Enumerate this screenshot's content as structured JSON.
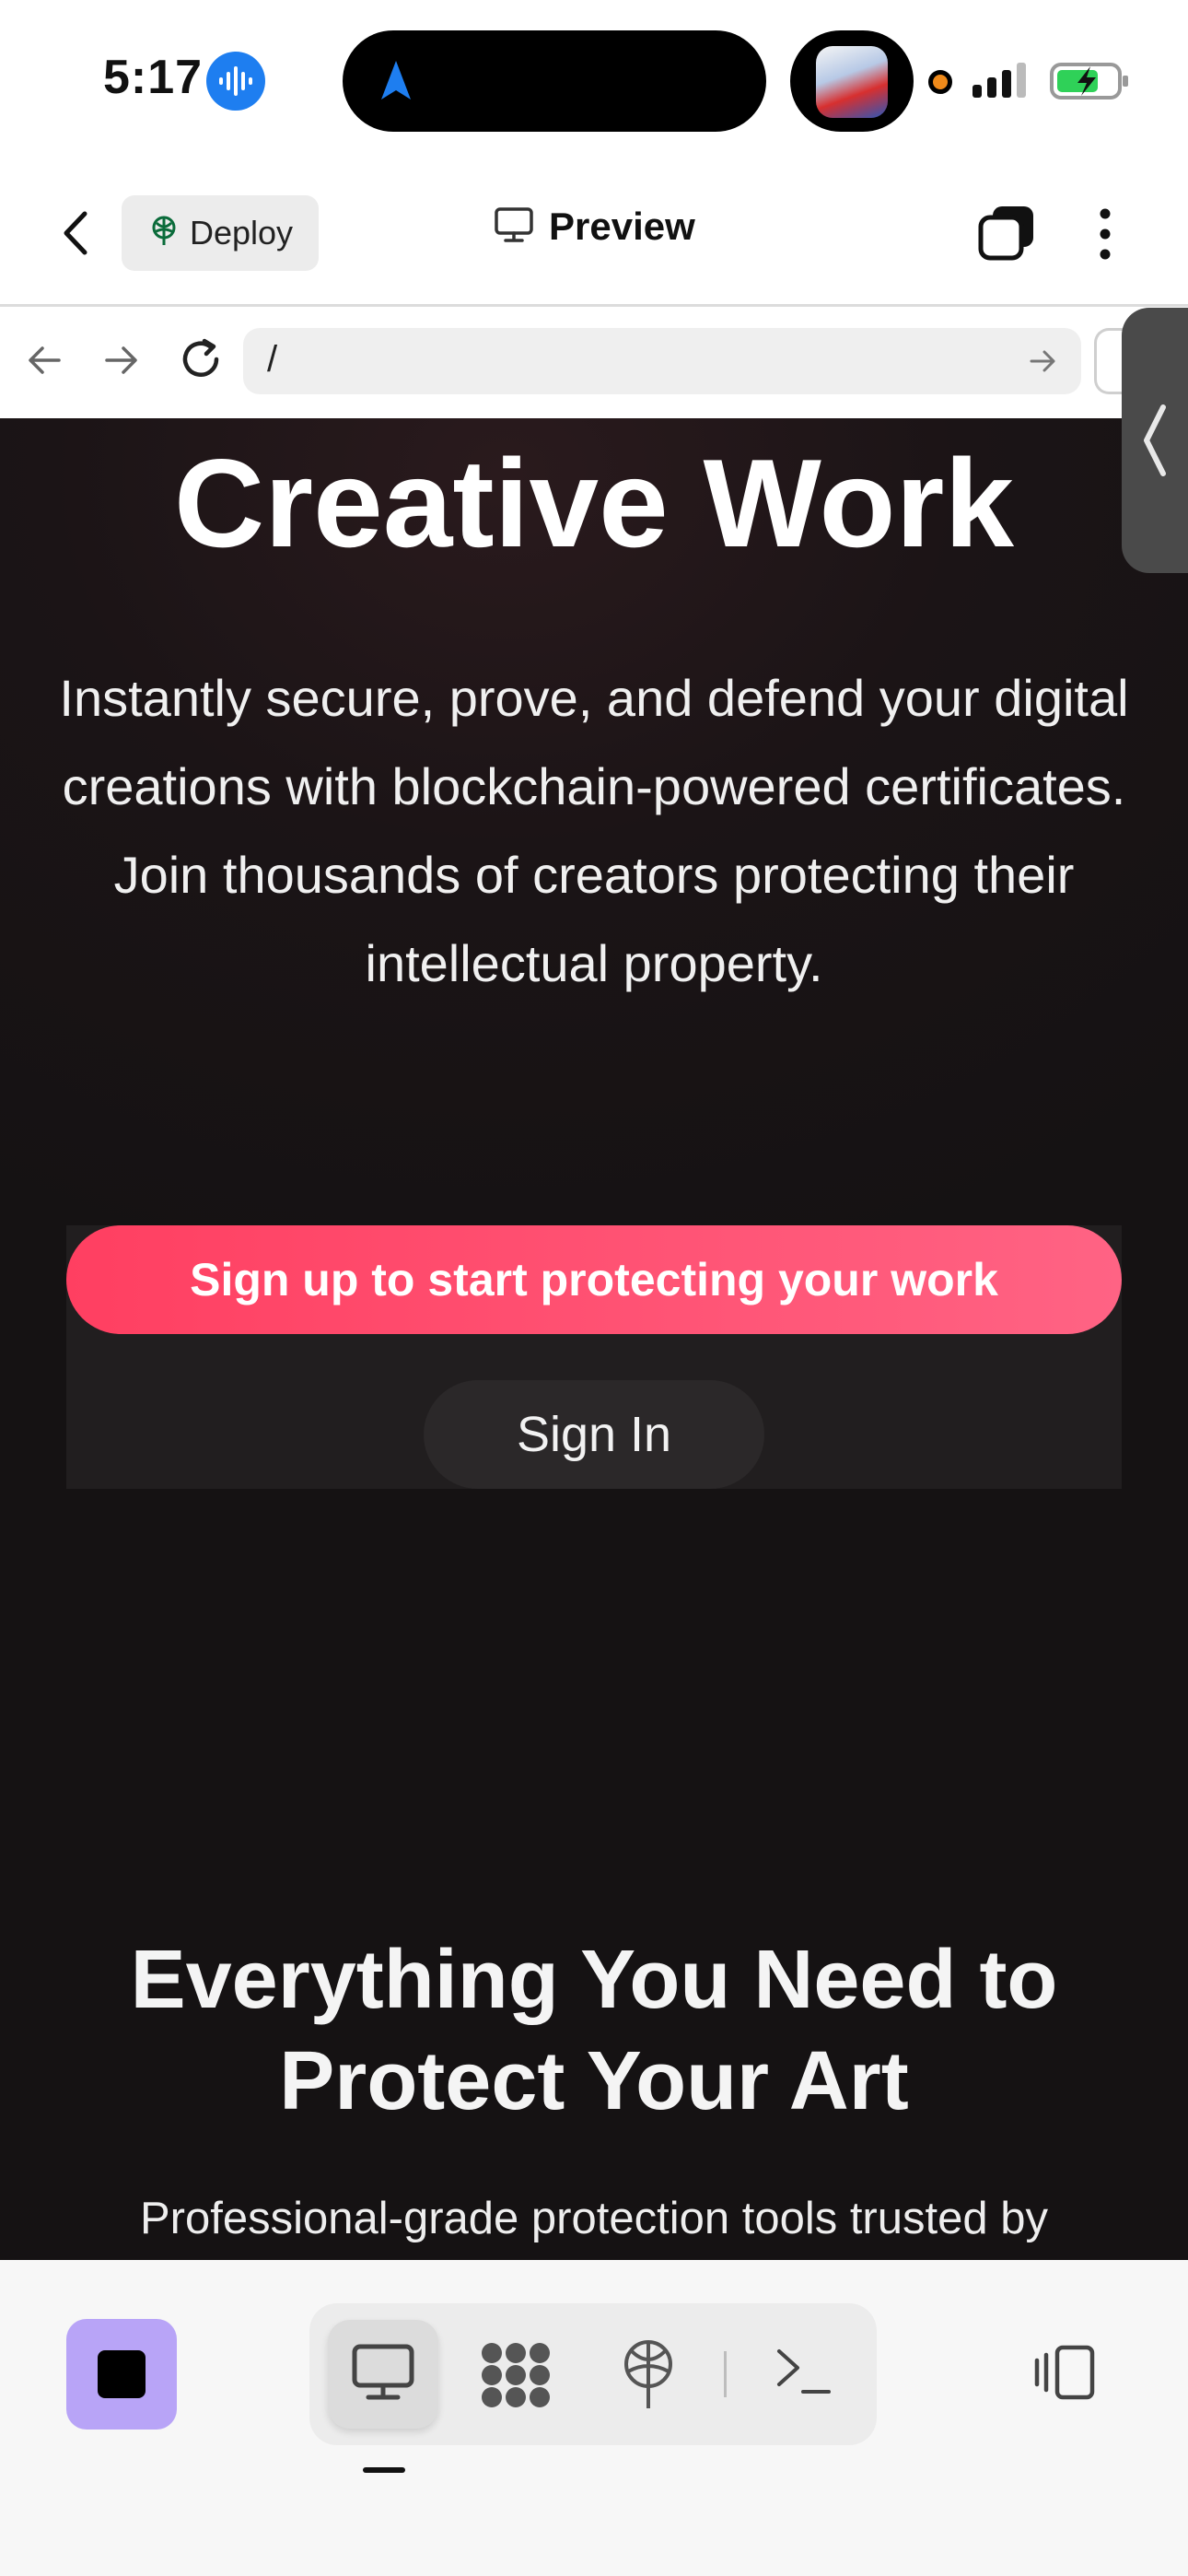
{
  "status_bar": {
    "time": "5:17"
  },
  "app_header": {
    "deploy_label": "Deploy",
    "preview_label": "Preview"
  },
  "browser": {
    "url": "/"
  },
  "hero": {
    "title": "Creative Work",
    "description": "Instantly secure, prove, and defend your digital creations with blockchain-powered certificates. Join thousands of creators protecting their intellectual property.",
    "signup_label": "Sign up to start protecting your work",
    "signin_label": "Sign In"
  },
  "features": {
    "title": "Everything You Need to Protect Your Art",
    "description": "Professional-grade protection tools trusted by"
  },
  "colors": {
    "accent": "#ff4d6d",
    "stop_button": "#b8a4f7",
    "content_bg": "#171314"
  },
  "icons": [
    "siri-icon",
    "navigation-arrow-icon",
    "signal-icon",
    "battery-charging-icon",
    "chevron-left-icon",
    "deploy-icon",
    "monitor-icon",
    "tabs-icon",
    "more-vertical-icon",
    "arrow-left-icon",
    "arrow-right-icon",
    "reload-icon",
    "go-arrow-icon",
    "stop-icon",
    "desktop-icon",
    "grid-icon",
    "terminal-icon",
    "panel-toggle-icon"
  ]
}
